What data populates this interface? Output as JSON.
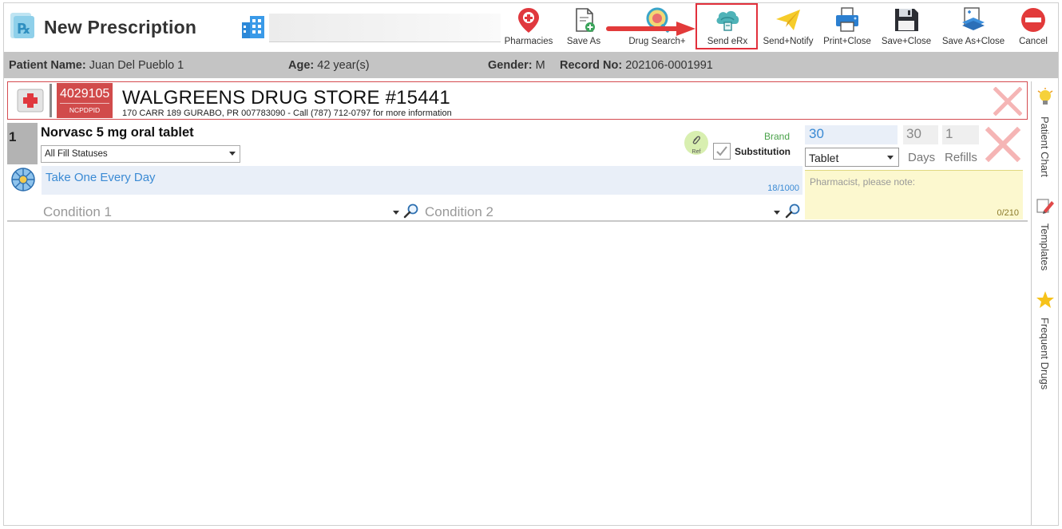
{
  "app": {
    "title": "New Prescription"
  },
  "toolbar": {
    "buttons": [
      {
        "id": "pharmacies",
        "label": "Pharmacies",
        "icon": "map-pin-icon"
      },
      {
        "id": "save-as",
        "label": "Save As",
        "icon": "document-add-icon"
      },
      {
        "id": "drug-search",
        "label": "Drug Search+",
        "icon": "pill-search-icon"
      },
      {
        "id": "send-erx",
        "label": "Send eRx",
        "icon": "cloud-send-icon",
        "highlighted": true
      },
      {
        "id": "send-notify",
        "label": "Send+Notify",
        "icon": "paper-plane-icon"
      },
      {
        "id": "print-close",
        "label": "Print+Close",
        "icon": "printer-icon"
      },
      {
        "id": "save-close",
        "label": "Save+Close",
        "icon": "floppy-icon"
      },
      {
        "id": "save-as-close",
        "label": "Save As+Close",
        "icon": "document-stack-icon"
      },
      {
        "id": "cancel",
        "label": "Cancel",
        "icon": "no-entry-icon"
      }
    ]
  },
  "patient": {
    "name_label": "Patient Name:",
    "name": "Juan Del Pueblo 1",
    "age_label": "Age:",
    "age": "42 year(s)",
    "gender_label": "Gender:",
    "gender": "M",
    "record_label": "Record No:",
    "record": "202106-0001991"
  },
  "pharmacy": {
    "ncpdp_id": "4029105",
    "ncpdp_label": "NCPDPID",
    "name": "WALGREENS DRUG STORE #15441",
    "address": "170 CARR 189 GURABO, PR 007783090 - Call (787) 712-0797 for more information"
  },
  "prescription": {
    "row_number": "1",
    "drug_name": "Norvasc 5 mg oral tablet",
    "fill_status": "All Fill Statuses",
    "sig": "Take One Every Day",
    "sig_count": "18/1000",
    "condition1_placeholder": "Condition 1",
    "condition2_placeholder": "Condition 2",
    "ref_label": "Ref",
    "brand_label": "Brand",
    "substitution_label": "Substitution",
    "substitution_checked": true,
    "quantity": "30",
    "unit": "Tablet",
    "days": "30",
    "days_label": "Days",
    "refills": "1",
    "refills_label": "Refills",
    "note_placeholder": "Pharmacist, please note:",
    "note_count": "0/210"
  },
  "side_panel": {
    "items": [
      {
        "label": "Patient Chart",
        "icon": "lightbulb-icon"
      },
      {
        "label": "Templates",
        "icon": "pencil-icon"
      },
      {
        "label": "Frequent Drugs",
        "icon": "star-icon"
      }
    ]
  },
  "colors": {
    "accent_blue": "#3a8ad4",
    "pharmacy_red": "#d14b4b",
    "highlight_red": "#e2303c",
    "remove_x": "#f5b5b5",
    "patient_bar": "#c4c4c4",
    "brand_green": "#4aa24a",
    "note_bg": "#fcf8cf"
  }
}
